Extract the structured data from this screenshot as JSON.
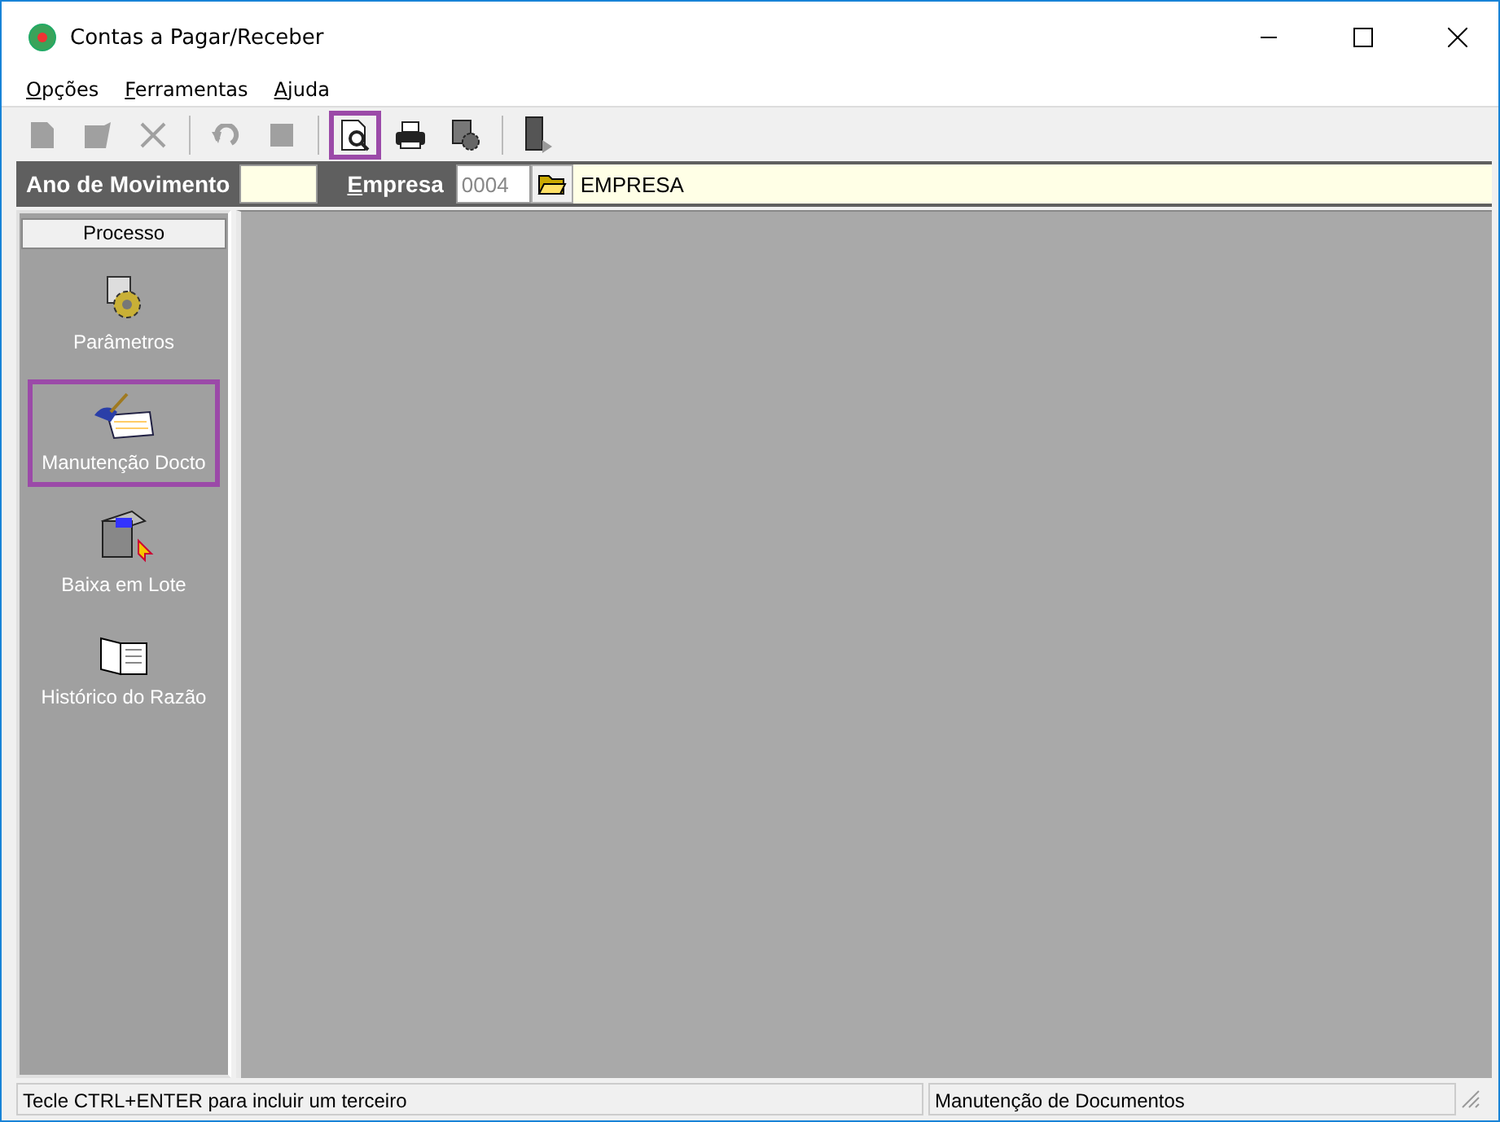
{
  "window": {
    "title": "Contas a Pagar/Receber"
  },
  "menu": [
    {
      "label": "Opções"
    },
    {
      "label": "Ferramentas"
    },
    {
      "label": "Ajuda"
    }
  ],
  "toolbar": [
    {
      "kind": "button",
      "disabled": true,
      "highlighted": false
    },
    {
      "kind": "button",
      "disabled": true,
      "highlighted": false
    },
    {
      "kind": "button",
      "disabled": true,
      "highlighted": false
    },
    {
      "kind": "separator"
    },
    {
      "kind": "button",
      "disabled": true,
      "highlighted": false
    },
    {
      "kind": "button",
      "disabled": true,
      "highlighted": false
    },
    {
      "kind": "separator"
    },
    {
      "kind": "button",
      "disabled": false,
      "highlighted": true
    },
    {
      "kind": "button",
      "disabled": false,
      "highlighted": false
    },
    {
      "kind": "button",
      "disabled": false,
      "highlighted": false
    },
    {
      "kind": "separator"
    },
    {
      "kind": "button",
      "disabled": false,
      "highlighted": false
    }
  ],
  "header": {
    "year_label": "Ano de Movimento",
    "company_label": "Empresa",
    "company_code": "0004",
    "company_name": "EMPRESA"
  },
  "sidebar": {
    "title": "Processo",
    "items": [
      {
        "label": "Parâmetros",
        "highlighted": false
      },
      {
        "label": "Manutenção Docto",
        "highlighted": true
      },
      {
        "label": "Baixa em Lote",
        "highlighted": false
      },
      {
        "label": "Histórico do Razão",
        "highlighted": false
      }
    ]
  },
  "status_bar": [
    "Tecle CTRL+ENTER para incluir um terceiro",
    "Manutenção de Documentos"
  ]
}
